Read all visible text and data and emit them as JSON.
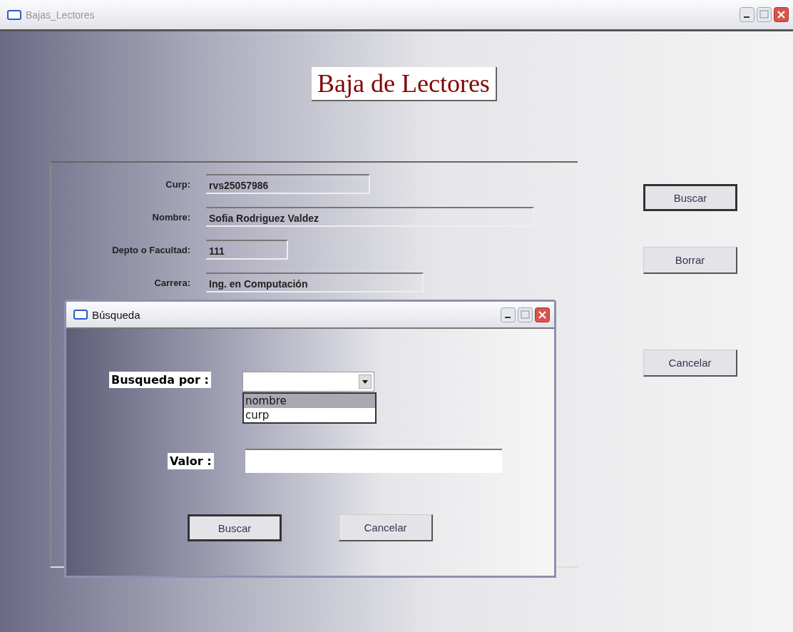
{
  "window": {
    "title": "Bajas_Lectores"
  },
  "heading": "Baja de Lectores",
  "fields": [
    {
      "label": "Curp:",
      "value": "rvs25057986"
    },
    {
      "label": "Nombre:",
      "value": "Sofia Rodriguez Valdez"
    },
    {
      "label": "Depto o Facultad:",
      "value": "111"
    },
    {
      "label": "Carrera:",
      "value": "Ing. en Computación"
    }
  ],
  "buttons": [
    {
      "label": "Buscar",
      "default": true
    },
    {
      "label": "Borrar",
      "default": false
    },
    {
      "label": "Cancelar",
      "default": false
    }
  ],
  "dialog": {
    "title": "Búsqueda",
    "search_by": {
      "label": "Busqueda por :",
      "expanded": true,
      "options": [
        {
          "label": "nombre",
          "selected": true
        },
        {
          "label": "curp",
          "selected": false
        }
      ]
    },
    "value_field": {
      "label": "Valor :"
    },
    "buttons": [
      {
        "label": "Buscar",
        "default": true
      },
      {
        "label": "Cancelar",
        "default": false
      }
    ]
  }
}
